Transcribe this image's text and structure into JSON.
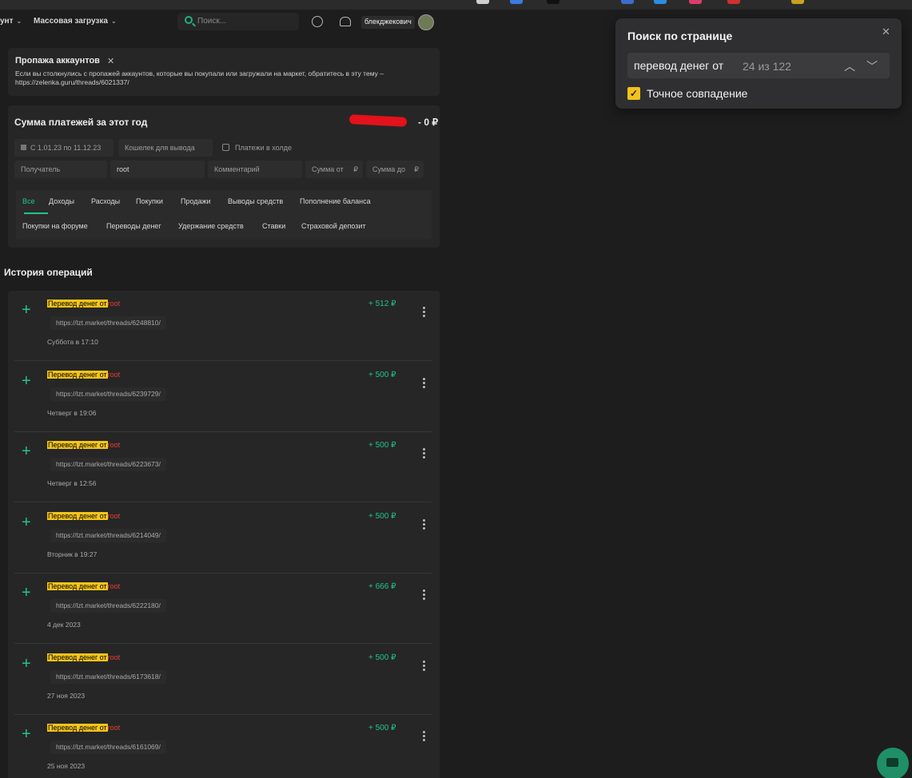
{
  "navbar": {
    "account_label": "унт",
    "bulk_upload_label": "Массовая загрузка",
    "search_placeholder": "Поиск...",
    "username": "блекджекович"
  },
  "notice": {
    "title": "Пропажа аккаунтов",
    "close": "✕",
    "text": "Если вы столкнулись с пропажей аккаунтов, которые вы покупали или загружали на маркет, обратитесь в эту тему – https://zelenka.guru/threads/6021337/"
  },
  "payments": {
    "title": "Сумма платежей за этот год",
    "amount": "- 0 ₽",
    "filters": {
      "date_range": "С 1.01.23 по 11.12.23",
      "wallet_placeholder": "Кошелек для вывода",
      "hold_label": "Платежи в холде",
      "recipient_placeholder": "Получатель",
      "sender_value": "root",
      "comment_placeholder": "Комментарий",
      "sum_from_placeholder": "Сумма от",
      "sum_to_placeholder": "Сумма до",
      "currency": "₽"
    },
    "tabs_row1": [
      "Все",
      "Доходы",
      "Расходы",
      "Покупки",
      "Продажи",
      "Выводы средств",
      "Пополнение баланса"
    ],
    "tabs_row2": [
      "Покупки на форуме",
      "Переводы денег",
      "Удержание средств",
      "Ставки",
      "Страховой депозит"
    ]
  },
  "history": {
    "title": "История операций",
    "operations": [
      {
        "highlight": "Перевод денег от",
        "user": "root",
        "link": "https://lzt.market/threads/6248810/",
        "date": "Суббота в 17:10",
        "amount": "+ 512 ₽"
      },
      {
        "highlight": "Перевод денег от",
        "user": "root",
        "link": "https://lzt.market/threads/6239729/",
        "date": "Четверг в 19:06",
        "amount": "+ 500 ₽"
      },
      {
        "highlight": "Перевод денег от",
        "user": "root",
        "link": "https://lzt.market/threads/6223673/",
        "date": "Четверг в 12:56",
        "amount": "+ 500 ₽"
      },
      {
        "highlight": "Перевод денег от",
        "user": "root",
        "link": "https://lzt.market/threads/6214049/",
        "date": "Вторник в 19:27",
        "amount": "+ 500 ₽"
      },
      {
        "highlight": "Перевод денег от",
        "user": "root",
        "link": "https://lzt.market/threads/6222180/",
        "date": "4 дек 2023",
        "amount": "+ 666 ₽"
      },
      {
        "highlight": "Перевод денег от",
        "user": "root",
        "link": "https://lzt.market/threads/6173618/",
        "date": "27 ноя 2023",
        "amount": "+ 500 ₽"
      },
      {
        "highlight": "Перевод денег от",
        "user": "root",
        "link": "https://lzt.market/threads/6161069/",
        "date": "25 ноя 2023",
        "amount": "+ 500 ₽"
      }
    ]
  },
  "find": {
    "title": "Поиск по странице",
    "close": "✕",
    "query": "перевод денег от",
    "count": "24 из 122",
    "prev": "︿",
    "next": "﹀",
    "exact_match_label": "Точное совпадение",
    "exact_match_checked": true
  },
  "colors": {
    "accent_green": "#1fc68c",
    "highlight_yellow": "#f6c51a",
    "username_red": "#ef3b3b"
  }
}
